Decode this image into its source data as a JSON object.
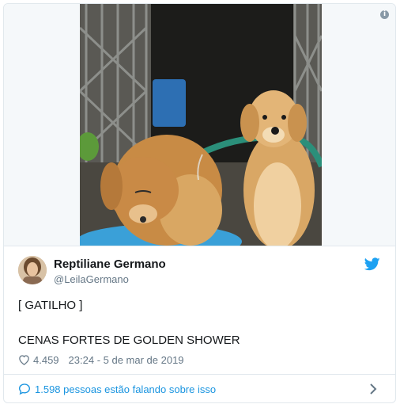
{
  "tweet": {
    "author_name": "Reptiliane Germano",
    "author_handle": "@LeilaGermano",
    "text_line1": "[ GATILHO ]",
    "text_line2": "CENAS FORTES DE GOLDEN SHOWER",
    "likes": "4.459",
    "timestamp": "23:24 - 5 de mar de 2019"
  },
  "footer": {
    "conversation_text": "1.598 pessoas estão falando sobre isso"
  },
  "media": {
    "info_glyph": "i"
  },
  "colors": {
    "link": "#1b95e0",
    "muted": "#657786",
    "border": "#e1e8ed"
  }
}
